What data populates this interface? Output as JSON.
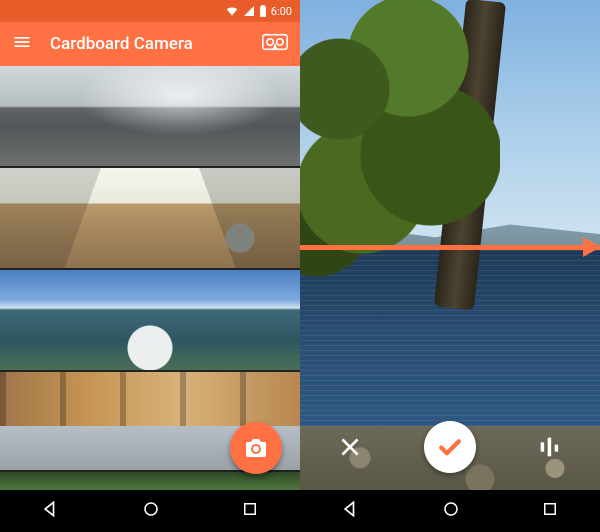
{
  "colors": {
    "accent": "#ff7043",
    "accent_dark": "#e85d2a"
  },
  "status": {
    "time": "6:00"
  },
  "appbar": {
    "title": "Cardboard Camera"
  },
  "icons": {
    "menu": "menu-icon",
    "cardboard": "cardboard-icon",
    "camera": "camera-icon",
    "close": "close-icon",
    "check": "check-icon",
    "audio": "audio-levels-icon",
    "wifi": "wifi-icon",
    "signal": "signal-icon",
    "battery": "battery-icon",
    "back_nav": "nav-back-icon",
    "home_nav": "nav-home-icon",
    "recent_nav": "nav-recent-icon"
  },
  "gallery": {
    "items": [
      {
        "name": "mountain-clouds-panorama"
      },
      {
        "name": "rv-interior-panorama"
      },
      {
        "name": "geyser-lake-panorama"
      },
      {
        "name": "colonnade-boardwalk-panorama"
      },
      {
        "name": "green-foliage-panorama"
      }
    ]
  },
  "capture": {
    "scene": "lakeside-tree-panorama",
    "controls": {
      "cancel": "Cancel",
      "confirm": "Done",
      "audio": "Audio levels"
    }
  }
}
